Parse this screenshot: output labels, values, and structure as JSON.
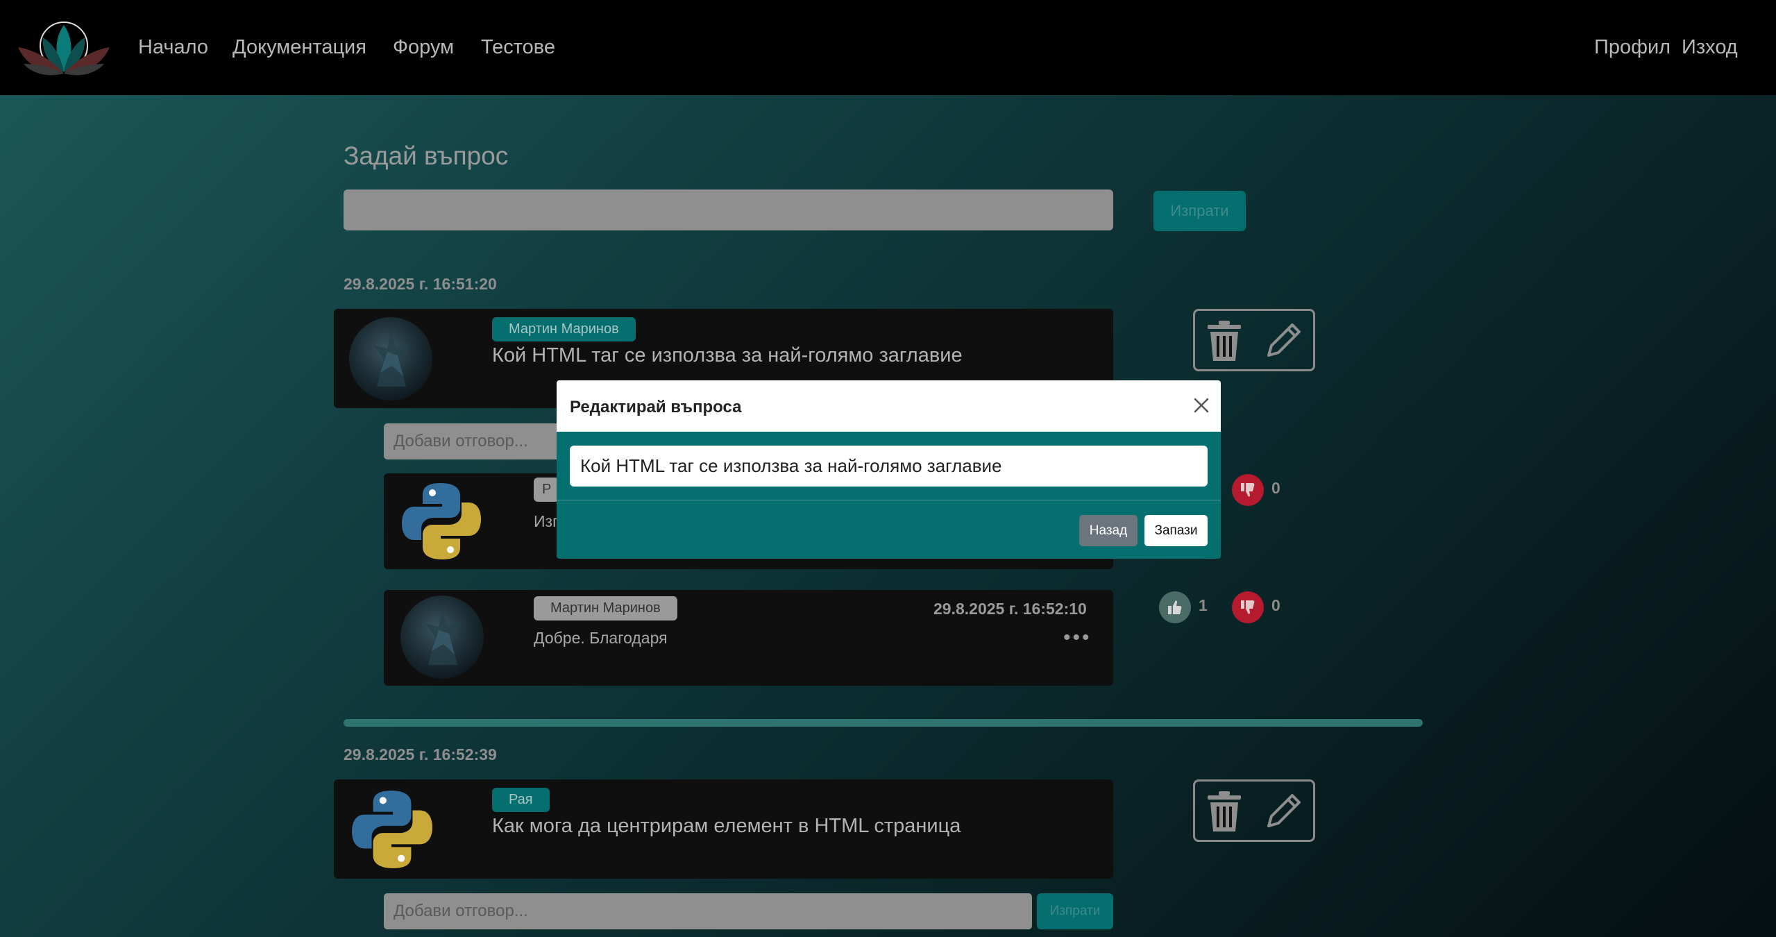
{
  "nav": {
    "links": [
      "Начало",
      "Документация",
      "Форум",
      "Тестове"
    ],
    "profile": "Профил",
    "logout": "Изход"
  },
  "ask": {
    "heading": "Задай въпрос",
    "send": "Изпрати"
  },
  "questions": [
    {
      "timestamp": "29.8.2025 г. 16:51:20",
      "author": "Мартин Маринов",
      "title": "Кой HTML таг се използва за най-голямо заглавие",
      "reply_placeholder": "Добави отговор...",
      "answers": [
        {
          "author_partial": "Р",
          "text_partial": "Изп",
          "likes": "",
          "dislikes": "0"
        },
        {
          "author": "Мартин Маринов",
          "timestamp": "29.8.2025 г. 16:52:10",
          "text": "Добре. Благодаря",
          "likes": "1",
          "dislikes": "0",
          "menu": "•••"
        }
      ]
    },
    {
      "timestamp": "29.8.2025 г. 16:52:39",
      "author": "Рая",
      "title": "Как мога да центрирам елемент в HTML страница",
      "reply_placeholder": "Добави отговор...",
      "reply_send": "Изпрати"
    }
  ],
  "modal": {
    "title": "Редактирай въпроса",
    "value": "Кой HTML таг се използва за най-голямо заглавие",
    "back": "Назад",
    "save": "Запази"
  },
  "colors": {
    "navbar": "#000000",
    "teal": "#056f6f",
    "card": "#0f0f0f",
    "dislike": "#b51a2e"
  }
}
